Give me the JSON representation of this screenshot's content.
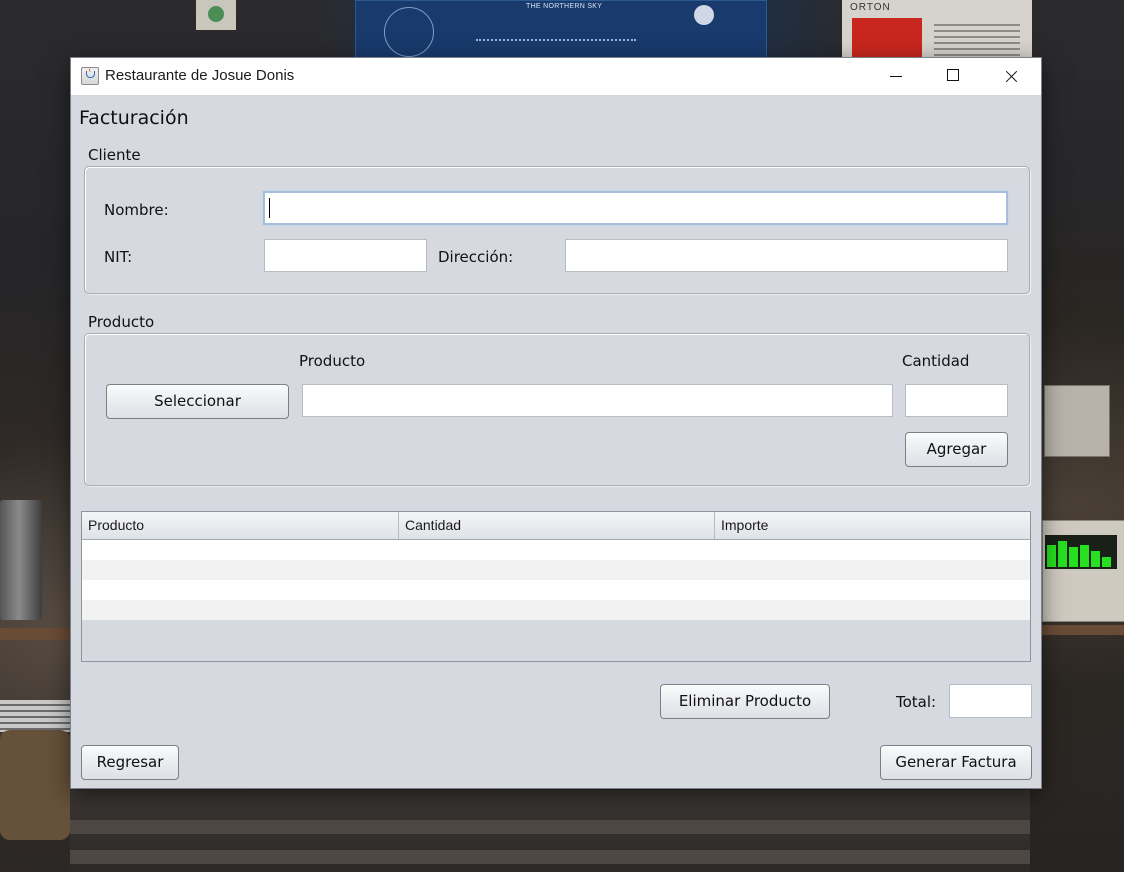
{
  "window": {
    "title": "Restaurante de Josue Donis"
  },
  "page_title": "Facturación",
  "cliente": {
    "section_label": "Cliente",
    "nombre_label": "Nombre:",
    "nombre_value": "",
    "nit_label": "NIT:",
    "nit_value": "",
    "direccion_label": "Dirección:",
    "direccion_value": ""
  },
  "producto": {
    "section_label": "Producto",
    "producto_label": "Producto",
    "cantidad_label": "Cantidad",
    "seleccionar_button": "Seleccionar",
    "producto_value": "",
    "cantidad_value": "",
    "agregar_button": "Agregar"
  },
  "table": {
    "columns": [
      "Producto",
      "Cantidad",
      "Importe"
    ],
    "rows": []
  },
  "footer": {
    "eliminar_button": "Eliminar Producto",
    "total_label": "Total:",
    "total_value": "",
    "regresar_button": "Regresar",
    "generar_button": "Generar Factura"
  },
  "desktop": {
    "poster_text": "THE NORTHERN SKY",
    "paper_header": "ORTON"
  },
  "colors": {
    "window_bg": "#d6d9df",
    "titlebar_bg": "#ffffff",
    "meter_green": "#27e021"
  }
}
